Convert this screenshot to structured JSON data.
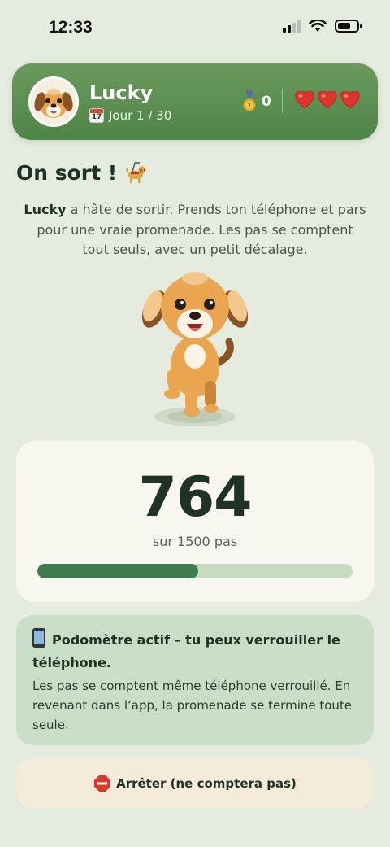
{
  "status_bar": {
    "time": "12:33"
  },
  "header": {
    "pet_name": "Lucky",
    "calendar_icon_day": "17",
    "day_label": "Jour 1 / 30",
    "medal_count": "0",
    "hearts": 3
  },
  "main": {
    "title": "On sort !",
    "intro_name": "Lucky",
    "intro_text": " a hâte de sortir. Prends ton téléphone et pars pour une vraie promenade. Les pas se comptent tout seuls, avec un petit décalage.",
    "steps": "764",
    "steps_goal": "sur 1500 pas",
    "progress": 0.5093
  },
  "pedometer_card": {
    "title": "Podomètre actif – tu peux verrouiller le téléphone.",
    "body": "Les pas se comptent même téléphone verrouillé. En revenant dans l’app, la promenade se termine toute seule."
  },
  "stop_button": {
    "label": "Arrêter (ne comptera pas)"
  },
  "colors": {
    "background": "#e5ecdf",
    "header_green": "#5a8f50",
    "progress_fill": "#3f7b4c",
    "progress_track": "#c6dbc0",
    "info_card": "#c9dec6",
    "stop_button": "#f4ebd8"
  },
  "icons": [
    "signal-icon",
    "wifi-icon",
    "battery-icon",
    "calendar-icon",
    "medal-icon",
    "heart-icon",
    "guide-dog-icon",
    "phone-icon",
    "stop-sign-icon"
  ]
}
